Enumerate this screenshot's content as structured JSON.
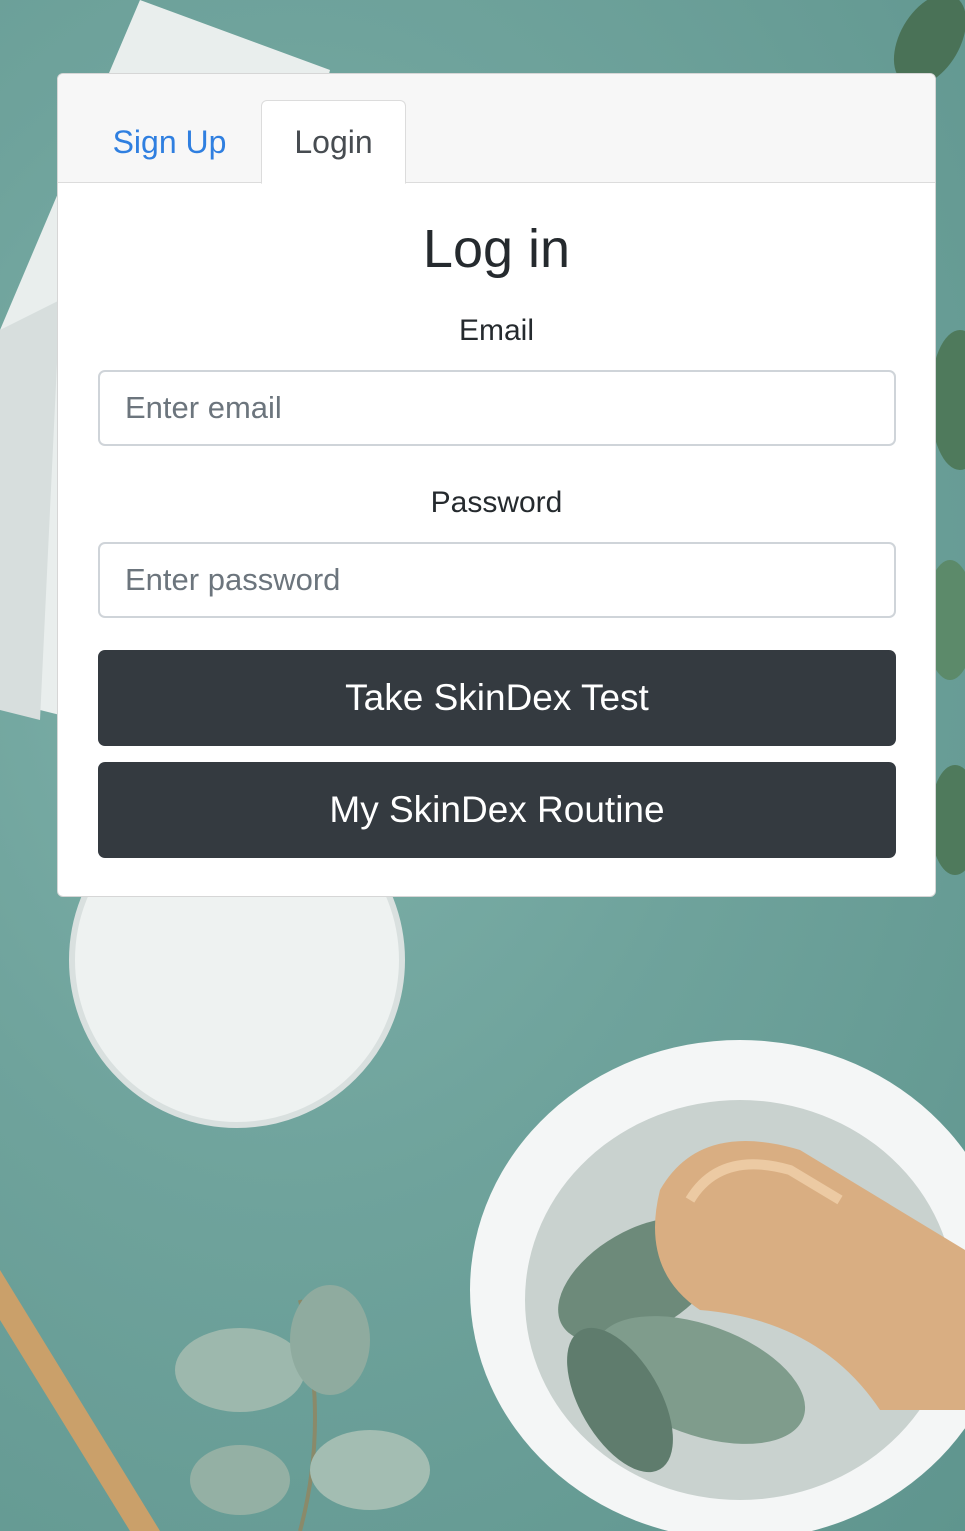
{
  "tabs": {
    "signup_label": "Sign Up",
    "login_label": "Login",
    "active": "login"
  },
  "form": {
    "title": "Log in",
    "email_label": "Email",
    "email_placeholder": "Enter email",
    "password_label": "Password",
    "password_placeholder": "Enter password"
  },
  "actions": {
    "test_button_label": "Take SkinDex Test",
    "routine_button_label": "My SkinDex Routine"
  },
  "colors": {
    "tab_link": "#2f7fe0",
    "button_dark": "#343a40",
    "background": "#6fa39c"
  }
}
